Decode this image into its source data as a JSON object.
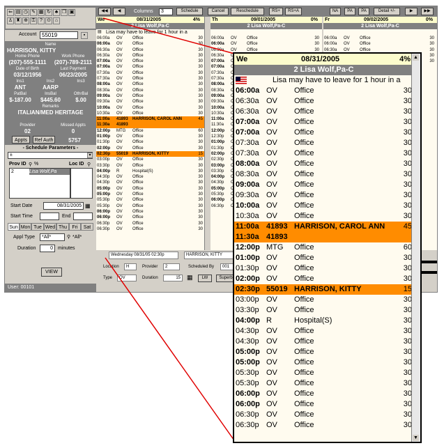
{
  "colors": {
    "highlight": "#ff8c00",
    "header_bg": "#fcfccc",
    "panel_bg": "#808080"
  },
  "toolbar_icons": [
    "back-icon",
    "printer-icon",
    "clock-icon",
    "pencil-icon",
    "calendar-icon",
    "refresh-icon",
    "bell-icon",
    "copy-icon",
    "stop-icon",
    "user-icon",
    "notes-icon",
    "globe-icon",
    "lock-icon",
    "help-icon",
    "search-icon",
    "home-icon"
  ],
  "patient": {
    "account_label": "Account",
    "account_value": "55019",
    "name_label": "Name",
    "name_value": "HARRISON, KITTY",
    "home_phone_label": "Home Phone",
    "home_phone_value": "(207)-555-1111",
    "work_phone_label": "Work Phone",
    "work_phone_value": "(207)-789-2111",
    "dob_label": "Date of Birth",
    "dob_value": "03/12/1956",
    "last_payment_label": "Last Payment",
    "last_payment_value": "06/23/2005",
    "ins1_label": "Ins1",
    "ins1_value": "ANT",
    "ins2_label": "Ins2",
    "ins2_value": "AARP",
    "ins3_label": "Ins3",
    "ins3_value": "",
    "patbal_label": "PatBal",
    "patbal_value": "$-187.00",
    "insbal_label": "InsBal",
    "insbal_value": "$445.60",
    "othbal_label": "OthrBal",
    "othbal_value": "$.00",
    "remarks_label": "Remarks",
    "remarks_value": "ITALIAN/MED HERITAGE",
    "provider_label": "Provider",
    "provider_value": "02",
    "missed_label": "Missed Appts",
    "missed_value": "0",
    "appts_btn": "Appts",
    "refauth_btn": "Ref Auth",
    "refauth_value": "5757"
  },
  "sched_params": {
    "title": "- Schedule Parameters -",
    "select_value": "±",
    "prov_id_label": "Prov ID",
    "prov_pct": "%",
    "loc_id_label": "Loc ID",
    "prov_list_value": "2",
    "prov_list_name": "Lisa Wolf,Pa",
    "start_date_label": "Start Date",
    "start_date_value": "08/31/2005",
    "start_time_label": "Start Time",
    "end_label": "End",
    "days": [
      "Sun",
      "Mon",
      "Tue",
      "Wed",
      "Thu",
      "Fri",
      "Sat"
    ],
    "active_day": "Sun",
    "appt_type_label": "Appl Type",
    "appt_type_value": "*All*",
    "appt_type_value2": "*All*",
    "duration_label": "Duration",
    "duration_value": "0",
    "minutes_label": "minutes",
    "view_btn": "VIEW",
    "user_label": "User: 00101"
  },
  "topbar": {
    "first_btn": "◀◀",
    "prev_btn": "◀",
    "columns_label": "Columns",
    "columns_value": "3",
    "schedule_btn": "Schedule",
    "cancel_btn": "Cancel",
    "reschedule_btn": "Reschedule",
    "rs_plus_btn": "RS+",
    "rs_plus2_btn": "RS+A",
    "na_btn": "NA",
    "pa_btn": "PA",
    "pa2_btn": "PA",
    "detail_btn": "Detail +/-",
    "next_btn": "▶",
    "last_btn": "▶▶"
  },
  "columns": [
    {
      "day": "We",
      "date": "08/31/2005",
      "pct": "4%",
      "provider": "2 Lisa Wolf,Pa-C",
      "note": "Lisa may have to leave for 1 hour in a",
      "rows": [
        {
          "time": "06:00a",
          "code": "OV",
          "desc": "Office",
          "dur": "30",
          "bold": false,
          "hl": false
        },
        {
          "time": "06:00a",
          "code": "OV",
          "desc": "Office",
          "dur": "30",
          "bold": true,
          "hl": false
        },
        {
          "time": "06:30a",
          "code": "OV",
          "desc": "Office",
          "dur": "30",
          "bold": false,
          "hl": false
        },
        {
          "time": "06:30a",
          "code": "OV",
          "desc": "Office",
          "dur": "30",
          "bold": false,
          "hl": false
        },
        {
          "time": "07:00a",
          "code": "OV",
          "desc": "Office",
          "dur": "30",
          "bold": true,
          "hl": false
        },
        {
          "time": "07:00a",
          "code": "OV",
          "desc": "Office",
          "dur": "30",
          "bold": true,
          "hl": false
        },
        {
          "time": "07:30a",
          "code": "OV",
          "desc": "Office",
          "dur": "30",
          "bold": false,
          "hl": false
        },
        {
          "time": "07:30a",
          "code": "OV",
          "desc": "Office",
          "dur": "30",
          "bold": false,
          "hl": false
        },
        {
          "time": "08:00a",
          "code": "OV",
          "desc": "Office",
          "dur": "30",
          "bold": true,
          "hl": false
        },
        {
          "time": "08:30a",
          "code": "OV",
          "desc": "Office",
          "dur": "30",
          "bold": false,
          "hl": false
        },
        {
          "time": "09:00a",
          "code": "OV",
          "desc": "Office",
          "dur": "30",
          "bold": true,
          "hl": false
        },
        {
          "time": "09:30a",
          "code": "OV",
          "desc": "Office",
          "dur": "30",
          "bold": false,
          "hl": false
        },
        {
          "time": "10:00a",
          "code": "OV",
          "desc": "Office",
          "dur": "30",
          "bold": true,
          "hl": false
        },
        {
          "time": "10:30a",
          "code": "OV",
          "desc": "Office",
          "dur": "30",
          "bold": false,
          "hl": false
        },
        {
          "time": "11:00a",
          "code": "41893",
          "desc": "HARRISON, CAROL ANN",
          "dur": "45",
          "bold": true,
          "hl": true
        },
        {
          "time": "11:30a",
          "code": "41893",
          "desc": "",
          "dur": "",
          "bold": false,
          "hl": true
        },
        {
          "time": "12:00p",
          "code": "MTG",
          "desc": "Office",
          "dur": "60",
          "bold": true,
          "hl": false
        },
        {
          "time": "01:00p",
          "code": "OV",
          "desc": "Office",
          "dur": "30",
          "bold": true,
          "hl": false
        },
        {
          "time": "01:30p",
          "code": "OV",
          "desc": "Office",
          "dur": "30",
          "bold": false,
          "hl": false
        },
        {
          "time": "02:00p",
          "code": "OV",
          "desc": "Office",
          "dur": "30",
          "bold": true,
          "hl": false
        },
        {
          "time": "02:30p",
          "code": "55019",
          "desc": "HARRISON, KITTY",
          "dur": "15",
          "bold": false,
          "hl": true
        },
        {
          "time": "03:00p",
          "code": "OV",
          "desc": "Office",
          "dur": "30",
          "bold": false,
          "hl": false
        },
        {
          "time": "03:30p",
          "code": "OV",
          "desc": "Office",
          "dur": "30",
          "bold": false,
          "hl": false
        },
        {
          "time": "04:00p",
          "code": "R",
          "desc": "Hospital(S)",
          "dur": "30",
          "bold": true,
          "hl": false
        },
        {
          "time": "04:30p",
          "code": "OV",
          "desc": "Office",
          "dur": "30",
          "bold": false,
          "hl": false
        },
        {
          "time": "04:30p",
          "code": "OV",
          "desc": "Office",
          "dur": "30",
          "bold": false,
          "hl": false
        },
        {
          "time": "05:00p",
          "code": "OV",
          "desc": "Office",
          "dur": "30",
          "bold": true,
          "hl": false
        },
        {
          "time": "05:00p",
          "code": "OV",
          "desc": "Office",
          "dur": "30",
          "bold": true,
          "hl": false
        },
        {
          "time": "05:30p",
          "code": "OV",
          "desc": "Office",
          "dur": "30",
          "bold": false,
          "hl": false
        },
        {
          "time": "05:30p",
          "code": "OV",
          "desc": "Office",
          "dur": "30",
          "bold": false,
          "hl": false
        },
        {
          "time": "06:00p",
          "code": "OV",
          "desc": "Office",
          "dur": "30",
          "bold": true,
          "hl": false
        },
        {
          "time": "06:00p",
          "code": "OV",
          "desc": "Office",
          "dur": "30",
          "bold": true,
          "hl": false
        },
        {
          "time": "06:30p",
          "code": "OV",
          "desc": "Office",
          "dur": "30",
          "bold": false,
          "hl": false
        },
        {
          "time": "06:30p",
          "code": "OV",
          "desc": "Office",
          "dur": "30",
          "bold": false,
          "hl": false
        }
      ]
    },
    {
      "day": "Th",
      "date": "09/01/2005",
      "pct": "0%",
      "provider": "2 Lisa Wolf,Pa-C",
      "note": "",
      "rows": [
        {
          "time": "06:00a",
          "code": "OV",
          "desc": "Office",
          "dur": "30",
          "bold": false,
          "hl": false
        },
        {
          "time": "06:00a",
          "code": "OV",
          "desc": "Office",
          "dur": "30",
          "bold": true,
          "hl": false
        },
        {
          "time": "06:30a",
          "code": "OV",
          "desc": "Office",
          "dur": "30",
          "bold": false,
          "hl": false
        },
        {
          "time": "06:30a",
          "code": "OV",
          "desc": "Office",
          "dur": "30",
          "bold": false,
          "hl": false
        },
        {
          "time": "07:00a",
          "code": "OV",
          "desc": "Office",
          "dur": "30",
          "bold": true,
          "hl": false
        },
        {
          "time": "07:00a",
          "code": "OV",
          "desc": "Office",
          "dur": "30",
          "bold": true,
          "hl": false
        },
        {
          "time": "07:30a",
          "code": "OV",
          "desc": "Office",
          "dur": "30",
          "bold": false,
          "hl": false
        },
        {
          "time": "07:30a",
          "code": "OV",
          "desc": "Office",
          "dur": "30",
          "bold": false,
          "hl": false
        },
        {
          "time": "08:00a",
          "code": "OV",
          "desc": "Office",
          "dur": "30",
          "bold": true,
          "hl": false
        },
        {
          "time": "08:30a",
          "code": "OV",
          "desc": "Office",
          "dur": "30",
          "bold": false,
          "hl": false
        },
        {
          "time": "09:00a",
          "code": "OV",
          "desc": "Office",
          "dur": "30",
          "bold": true,
          "hl": false
        },
        {
          "time": "09:30a",
          "code": "OV",
          "desc": "Office",
          "dur": "30",
          "bold": false,
          "hl": false
        },
        {
          "time": "10:00a",
          "code": "OV",
          "desc": "Office",
          "dur": "30",
          "bold": true,
          "hl": false
        },
        {
          "time": "10:30a",
          "code": "OV",
          "desc": "Office",
          "dur": "30",
          "bold": false,
          "hl": false
        },
        {
          "time": "11:00a",
          "code": "OV",
          "desc": "Office",
          "dur": "30",
          "bold": true,
          "hl": false
        },
        {
          "time": "11:30a",
          "code": "OV",
          "desc": "Office",
          "dur": "30",
          "bold": false,
          "hl": false
        },
        {
          "time": "12:00p",
          "code": "OV",
          "desc": "Office",
          "dur": "30",
          "bold": true,
          "hl": false
        },
        {
          "time": "12:30p",
          "code": "OV",
          "desc": "Office",
          "dur": "30",
          "bold": false,
          "hl": false
        },
        {
          "time": "01:00p",
          "code": "OV",
          "desc": "Office",
          "dur": "30",
          "bold": true,
          "hl": false
        },
        {
          "time": "01:30p",
          "code": "OV",
          "desc": "Office",
          "dur": "30",
          "bold": false,
          "hl": false
        },
        {
          "time": "02:00p",
          "code": "OV",
          "desc": "Office",
          "dur": "30",
          "bold": true,
          "hl": false
        },
        {
          "time": "02:30p",
          "code": "OV",
          "desc": "Office",
          "dur": "30",
          "bold": false,
          "hl": false
        },
        {
          "time": "03:00p",
          "code": "OV",
          "desc": "Office",
          "dur": "30",
          "bold": true,
          "hl": false
        },
        {
          "time": "03:30p",
          "code": "OV",
          "desc": "Office",
          "dur": "30",
          "bold": false,
          "hl": false
        },
        {
          "time": "04:00p",
          "code": "OV",
          "desc": "Office",
          "dur": "30",
          "bold": true,
          "hl": false
        },
        {
          "time": "04:30p",
          "code": "OV",
          "desc": "Office",
          "dur": "30",
          "bold": false,
          "hl": false
        },
        {
          "time": "05:00p",
          "code": "OV",
          "desc": "Office",
          "dur": "30",
          "bold": true,
          "hl": false
        },
        {
          "time": "05:30p",
          "code": "OV",
          "desc": "Office",
          "dur": "30",
          "bold": false,
          "hl": false
        },
        {
          "time": "06:00p",
          "code": "OV",
          "desc": "Office",
          "dur": "30",
          "bold": true,
          "hl": false
        },
        {
          "time": "06:30p",
          "code": "OV",
          "desc": "Office",
          "dur": "30",
          "bold": false,
          "hl": false
        }
      ]
    },
    {
      "day": "Fr",
      "date": "09/02/2005",
      "pct": "0%",
      "provider": "2 Lisa Wolf,Pa-C",
      "note": "",
      "rows": [
        {
          "time": "06:00a",
          "code": "OV",
          "desc": "Office",
          "dur": "30",
          "bold": false,
          "hl": false
        },
        {
          "time": "06:00a",
          "code": "OV",
          "desc": "Office",
          "dur": "30",
          "bold": false,
          "hl": false
        },
        {
          "time": "06:30a",
          "code": "OV",
          "desc": "Office",
          "dur": "30",
          "bold": false,
          "hl": false
        },
        {
          "time": "06:30a",
          "code": "OV",
          "desc": "Office",
          "dur": "30",
          "bold": false,
          "hl": false
        },
        {
          "time": "07:00a",
          "code": "OV",
          "desc": "Office",
          "dur": "30",
          "bold": false,
          "hl": false
        }
      ]
    }
  ],
  "bottom_panel": {
    "appt_datetime": "Wednesday 08/31/05 02:30p",
    "appt_patient": "HARRISON, KITTY",
    "location_label": "Location",
    "location_value": "H",
    "provider_label": "Provider",
    "provider_value": "2",
    "scheduled_by_label": "Scheduled By",
    "scheduled_by_value": "001",
    "type_label": "Type",
    "type_value": "OV",
    "duration_label": "Duration",
    "duration_value": "15",
    "lw_btn": "LW",
    "superbill_btn": "Superbill"
  }
}
